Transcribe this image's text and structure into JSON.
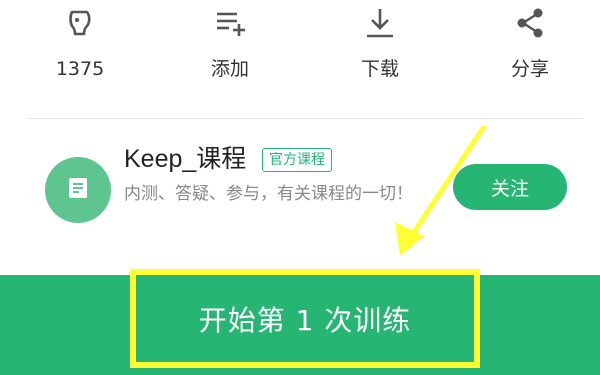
{
  "actions": [
    {
      "label": "1375",
      "icon": "like-icon"
    },
    {
      "label": "添加",
      "icon": "add-to-list-icon"
    },
    {
      "label": "下载",
      "icon": "download-icon"
    },
    {
      "label": "分享",
      "icon": "share-icon"
    }
  ],
  "course": {
    "title": "Keep_课程",
    "badge": "官方课程",
    "description": "内测、答疑、参与，有关课程的一切！",
    "follow_label": "关注",
    "avatar_icon": "document-icon"
  },
  "start": {
    "label": "开始第 1 次训练"
  },
  "colors": {
    "brand_green": "#27b573",
    "highlight_yellow": "#ffff32",
    "text_dark": "#333333",
    "text_muted": "#888888"
  },
  "annotation": {
    "arrow_icon": "pointer-arrow-icon"
  }
}
